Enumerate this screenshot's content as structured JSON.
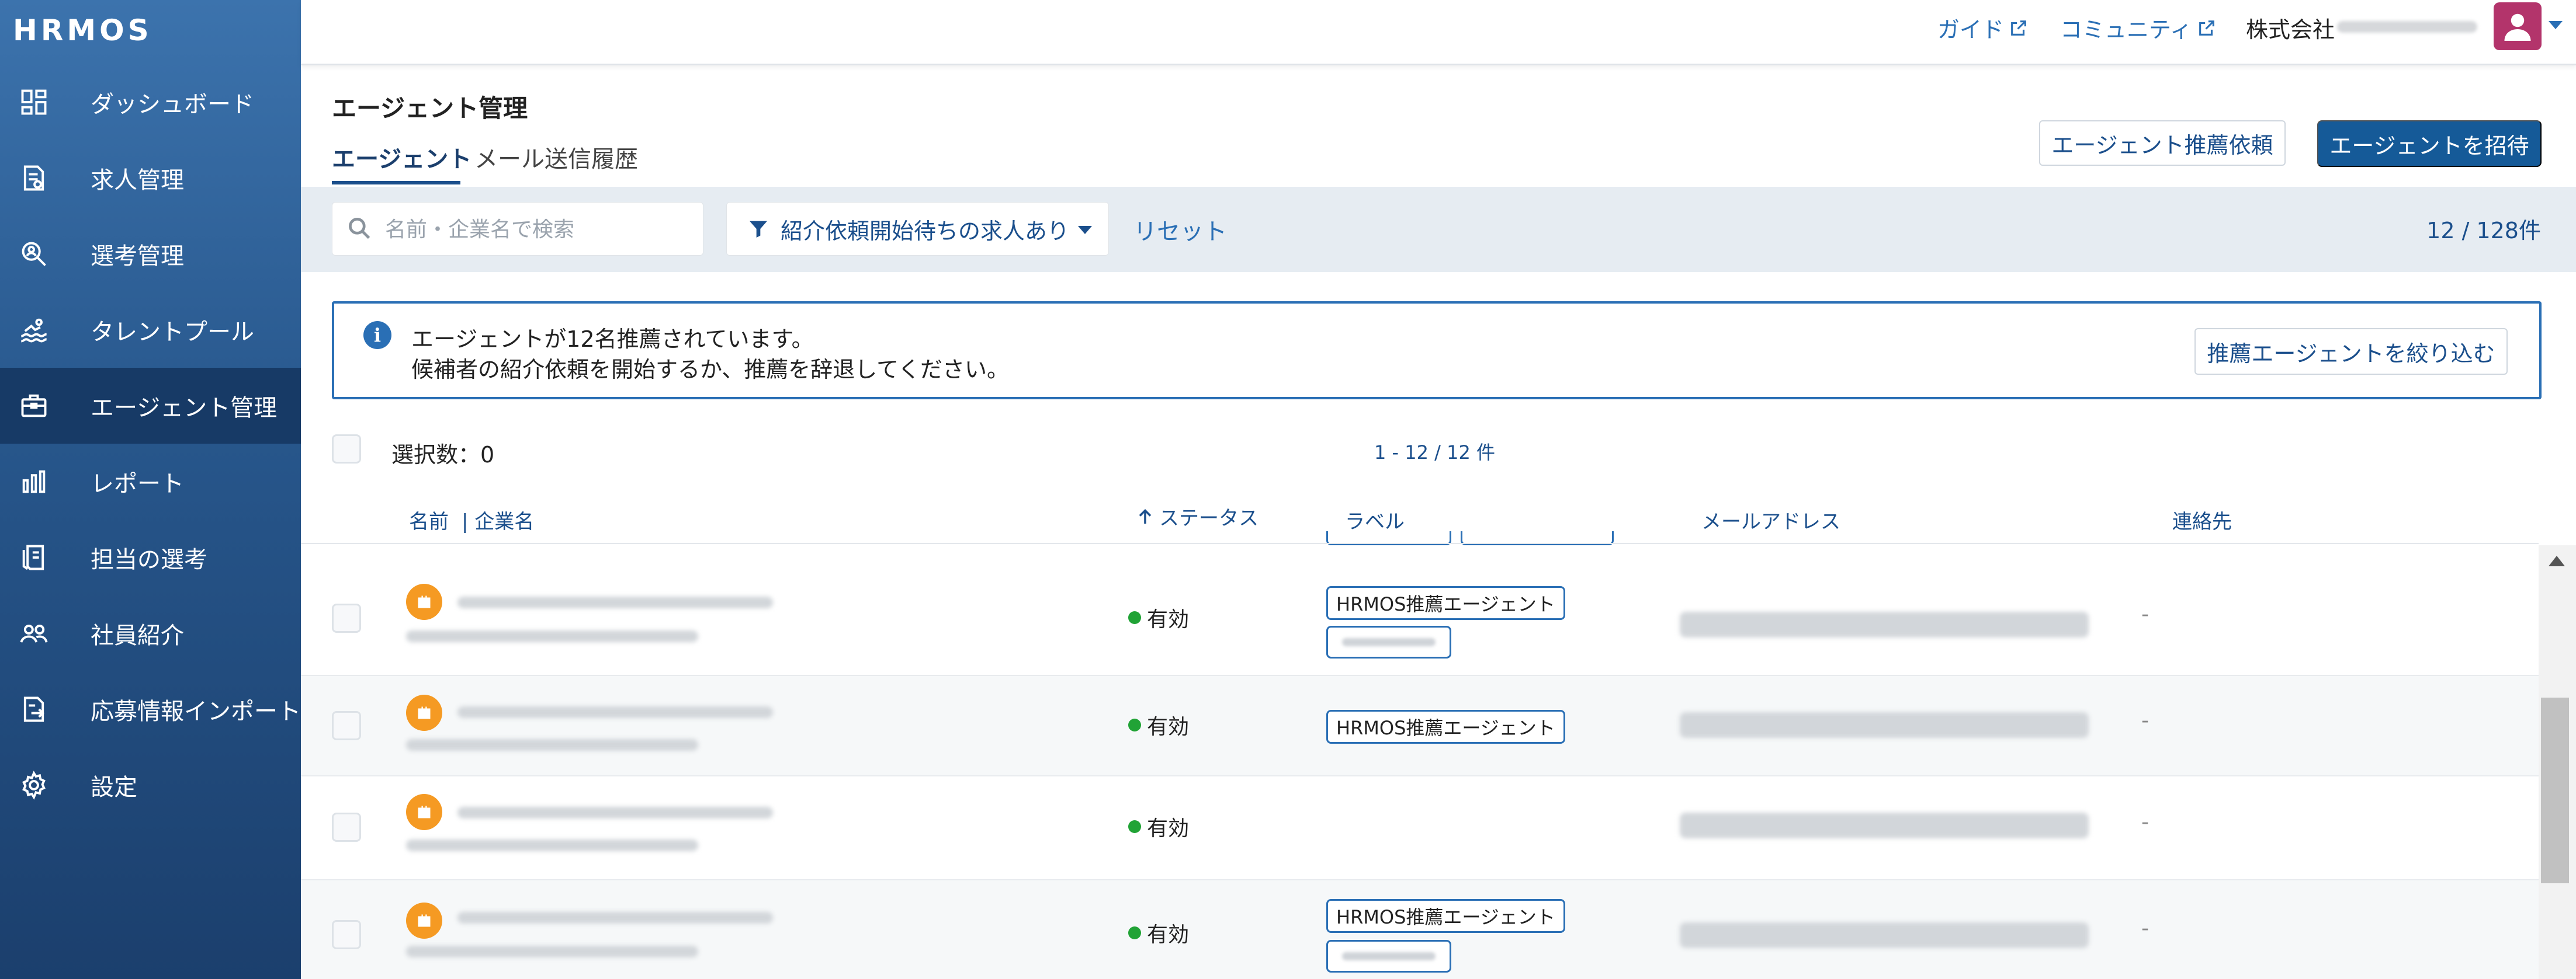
{
  "app": {
    "logo_text": "HRMOS"
  },
  "sidebar": {
    "items": [
      {
        "label": "ダッシュボード",
        "icon": "dashboard-icon"
      },
      {
        "label": "求人管理",
        "icon": "job-document-icon"
      },
      {
        "label": "選考管理",
        "icon": "magnifier-person-icon"
      },
      {
        "label": "タレントプール",
        "icon": "swimmer-icon"
      },
      {
        "label": "エージェント管理",
        "icon": "briefcase-icon",
        "active": true
      },
      {
        "label": "レポート",
        "icon": "bar-chart-icon"
      },
      {
        "label": "担当の選考",
        "icon": "assigned-documents-icon"
      },
      {
        "label": "社員紹介",
        "icon": "people-icon"
      },
      {
        "label": "応募情報インポート",
        "icon": "import-icon"
      },
      {
        "label": "設定",
        "icon": "gear-icon"
      }
    ]
  },
  "topbar": {
    "guide_label": "ガイド",
    "community_label": "コミュニティ",
    "company_label": "株式会社"
  },
  "header": {
    "title": "エージェント管理",
    "tabs": [
      {
        "label": "エージェント",
        "active": true
      },
      {
        "label": "メール送信履歴",
        "active": false
      }
    ],
    "recommend_request_label": "エージェント推薦依頼",
    "invite_label": "エージェントを招待"
  },
  "filters": {
    "search_placeholder": "名前・企業名で検索",
    "dropdown_label": "紹介依頼開始待ちの求人あり",
    "reset_label": "リセット",
    "count_label": "12 / 128件"
  },
  "banner": {
    "line1": "エージェントが12名推薦されています。",
    "line2": "候補者の紹介依頼を開始するか、推薦を辞退してください。",
    "button_label": "推薦エージェントを絞り込む"
  },
  "selection": {
    "label": "選択数：0",
    "pager": "1 - 12 / 12 件"
  },
  "table": {
    "columns": {
      "name": "名前",
      "company": "| 企業名",
      "status": "ステータス",
      "label": "ラベル",
      "email": "メールアドレス",
      "contact": "連絡先"
    },
    "rows": [
      {
        "status": "有効",
        "tag": "HRMOS推薦エージェント",
        "has_second_tag": true,
        "contact": "-"
      },
      {
        "status": "有効",
        "tag": "HRMOS推薦エージェント",
        "has_second_tag": false,
        "contact": "-"
      },
      {
        "status": "有効",
        "tag": "",
        "has_second_tag": false,
        "contact": "-"
      },
      {
        "status": "有効",
        "tag": "HRMOS推薦エージェント",
        "has_second_tag": true,
        "contact": "-"
      }
    ]
  },
  "colors": {
    "sidebar_top": "#3c73ad",
    "sidebar_bottom": "#1b3f6d",
    "accent": "#155a98",
    "link": "#2a6fb5",
    "status_active": "#21a336",
    "agent_badge": "#f59a23",
    "avatar": "#b3346b"
  }
}
